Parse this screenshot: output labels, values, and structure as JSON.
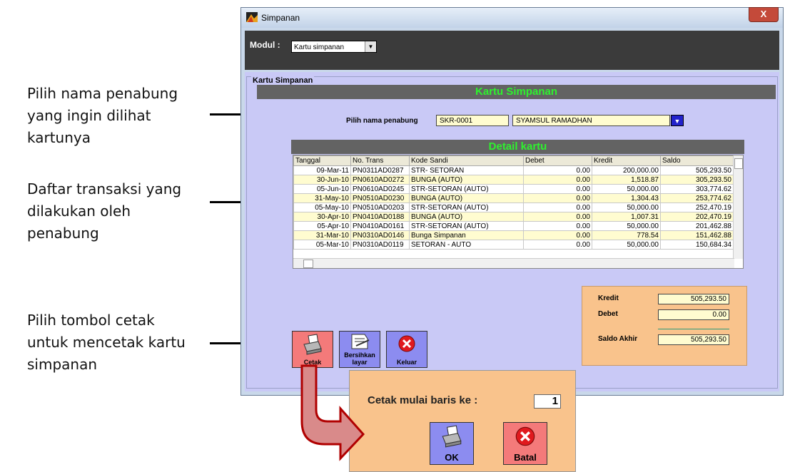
{
  "annotations": {
    "a1": [
      "Pilih nama penabung",
      "yang ingin dilihat",
      "kartunya"
    ],
    "a2": [
      "Daftar transaksi yang",
      "dilakukan oleh",
      "penabung"
    ],
    "a3": [
      "Pilih tombol cetak",
      "untuk mencetak kartu",
      "simpanan"
    ]
  },
  "window": {
    "title": "Simpanan",
    "close": "X"
  },
  "modul": {
    "label": "Modul :",
    "value": "Kartu simpanan"
  },
  "group": {
    "label": "Kartu Simpanan"
  },
  "header": {
    "title": "Kartu Simpanan"
  },
  "nasabah": {
    "label": "Pilih nama penabung",
    "code": "SKR-0001",
    "name": "SYAMSUL RAMADHAN"
  },
  "detail": {
    "title": "Detail kartu",
    "columns": [
      "Tanggal",
      "No. Trans",
      "Kode Sandi",
      "Debet",
      "Kredit",
      "Saldo"
    ],
    "rows": [
      [
        "09-Mar-11",
        "PN0311AD0287",
        "STR- SETORAN",
        "0.00",
        "200,000.00",
        "505,293.50"
      ],
      [
        "30-Jun-10",
        "PN0610AD0272",
        "BUNGA (AUTO)",
        "0.00",
        "1,518.87",
        "305,293.50"
      ],
      [
        "05-Jun-10",
        "PN0610AD0245",
        "STR-SETORAN (AUTO)",
        "0.00",
        "50,000.00",
        "303,774.62"
      ],
      [
        "31-May-10",
        "PN0510AD0230",
        "BUNGA (AUTO)",
        "0.00",
        "1,304.43",
        "253,774.62"
      ],
      [
        "05-May-10",
        "PN0510AD0203",
        "STR-SETORAN (AUTO)",
        "0.00",
        "50,000.00",
        "252,470.19"
      ],
      [
        "30-Apr-10",
        "PN0410AD0188",
        "BUNGA (AUTO)",
        "0.00",
        "1,007.31",
        "202,470.19"
      ],
      [
        "05-Apr-10",
        "PN0410AD0161",
        "STR-SETORAN (AUTO)",
        "0.00",
        "50,000.00",
        "201,462.88"
      ],
      [
        "31-Mar-10",
        "PN0310AD0146",
        "Bunga Simpanan",
        "0.00",
        "778.54",
        "151,462.88"
      ],
      [
        "05-Mar-10",
        "PN0310AD0119",
        "SETORAN - AUTO",
        "0.00",
        "50,000.00",
        "150,684.34"
      ]
    ]
  },
  "summary": {
    "kredit_label": "Kredit",
    "kredit": "505,293.50",
    "debet_label": "Debet",
    "debet": "0.00",
    "saldo_label": "Saldo Akhir",
    "saldo": "505,293.50"
  },
  "buttons": {
    "cetak": "Cetak",
    "bersihkan": [
      "Bersihkan",
      "layar"
    ],
    "keluar": "Keluar"
  },
  "popup": {
    "label": "Cetak mulai baris ke  :",
    "value": "1",
    "ok": "OK",
    "batal": "Batal"
  }
}
